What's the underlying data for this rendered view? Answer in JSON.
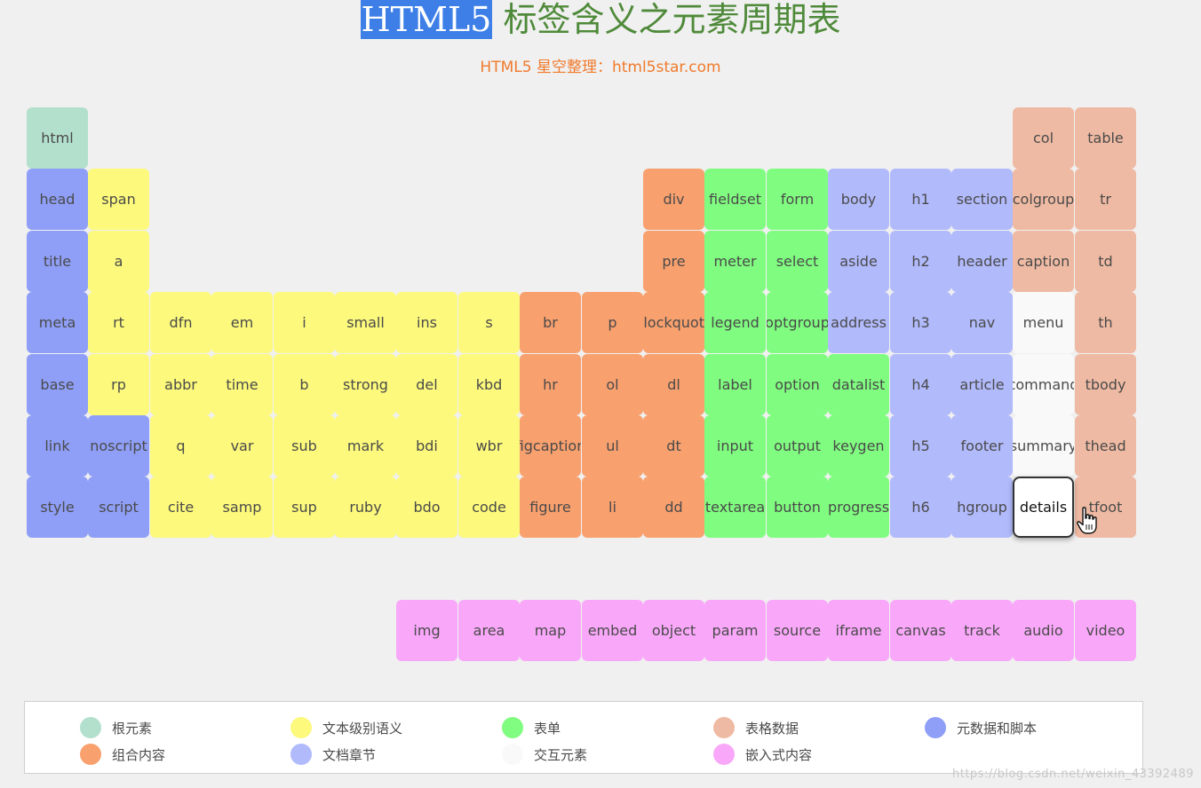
{
  "header": {
    "title_highlight": "HTML5",
    "title_rest": " 标签含义之元素周期表",
    "subtitle": "HTML5 星空整理：html5star.com"
  },
  "colors": {
    "root": "#b3e0cc",
    "text": "#fcf97c",
    "form": "#80fc80",
    "table": "#efbaa3",
    "meta": "#8f9ff7",
    "group": "#f8a06e",
    "section": "#b1bafb",
    "interactive": "#f9f9f9",
    "embed": "#f9a8f9"
  },
  "elements": [
    {
      "label": "html",
      "cat": "root",
      "col": 0,
      "row": 0
    },
    {
      "label": "col",
      "cat": "table",
      "col": 16,
      "row": 0
    },
    {
      "label": "table",
      "cat": "table",
      "col": 17,
      "row": 0
    },
    {
      "label": "head",
      "cat": "meta",
      "col": 0,
      "row": 1
    },
    {
      "label": "span",
      "cat": "text",
      "col": 1,
      "row": 1
    },
    {
      "label": "div",
      "cat": "group",
      "col": 10,
      "row": 1
    },
    {
      "label": "fieldset",
      "cat": "form",
      "col": 11,
      "row": 1
    },
    {
      "label": "form",
      "cat": "form",
      "col": 12,
      "row": 1
    },
    {
      "label": "body",
      "cat": "section",
      "col": 13,
      "row": 1
    },
    {
      "label": "h1",
      "cat": "section",
      "col": 14,
      "row": 1
    },
    {
      "label": "section",
      "cat": "section",
      "col": 15,
      "row": 1
    },
    {
      "label": "colgroup",
      "cat": "table",
      "col": 16,
      "row": 1
    },
    {
      "label": "tr",
      "cat": "table",
      "col": 17,
      "row": 1
    },
    {
      "label": "title",
      "cat": "meta",
      "col": 0,
      "row": 2
    },
    {
      "label": "a",
      "cat": "text",
      "col": 1,
      "row": 2
    },
    {
      "label": "pre",
      "cat": "group",
      "col": 10,
      "row": 2
    },
    {
      "label": "meter",
      "cat": "form",
      "col": 11,
      "row": 2
    },
    {
      "label": "select",
      "cat": "form",
      "col": 12,
      "row": 2
    },
    {
      "label": "aside",
      "cat": "section",
      "col": 13,
      "row": 2
    },
    {
      "label": "h2",
      "cat": "section",
      "col": 14,
      "row": 2
    },
    {
      "label": "header",
      "cat": "section",
      "col": 15,
      "row": 2
    },
    {
      "label": "caption",
      "cat": "table",
      "col": 16,
      "row": 2
    },
    {
      "label": "td",
      "cat": "table",
      "col": 17,
      "row": 2
    },
    {
      "label": "meta",
      "cat": "meta",
      "col": 0,
      "row": 3
    },
    {
      "label": "rt",
      "cat": "text",
      "col": 1,
      "row": 3
    },
    {
      "label": "dfn",
      "cat": "text",
      "col": 2,
      "row": 3
    },
    {
      "label": "em",
      "cat": "text",
      "col": 3,
      "row": 3
    },
    {
      "label": "i",
      "cat": "text",
      "col": 4,
      "row": 3
    },
    {
      "label": "small",
      "cat": "text",
      "col": 5,
      "row": 3
    },
    {
      "label": "ins",
      "cat": "text",
      "col": 6,
      "row": 3
    },
    {
      "label": "s",
      "cat": "text",
      "col": 7,
      "row": 3
    },
    {
      "label": "br",
      "cat": "group",
      "col": 8,
      "row": 3
    },
    {
      "label": "p",
      "cat": "group",
      "col": 9,
      "row": 3
    },
    {
      "label": "blockquote",
      "cat": "group",
      "col": 10,
      "row": 3
    },
    {
      "label": "legend",
      "cat": "form",
      "col": 11,
      "row": 3
    },
    {
      "label": "optgroup",
      "cat": "form",
      "col": 12,
      "row": 3
    },
    {
      "label": "address",
      "cat": "section",
      "col": 13,
      "row": 3
    },
    {
      "label": "h3",
      "cat": "section",
      "col": 14,
      "row": 3
    },
    {
      "label": "nav",
      "cat": "section",
      "col": 15,
      "row": 3
    },
    {
      "label": "menu",
      "cat": "interactive",
      "col": 16,
      "row": 3
    },
    {
      "label": "th",
      "cat": "table",
      "col": 17,
      "row": 3
    },
    {
      "label": "base",
      "cat": "meta",
      "col": 0,
      "row": 4
    },
    {
      "label": "rp",
      "cat": "text",
      "col": 1,
      "row": 4
    },
    {
      "label": "abbr",
      "cat": "text",
      "col": 2,
      "row": 4
    },
    {
      "label": "time",
      "cat": "text",
      "col": 3,
      "row": 4
    },
    {
      "label": "b",
      "cat": "text",
      "col": 4,
      "row": 4
    },
    {
      "label": "strong",
      "cat": "text",
      "col": 5,
      "row": 4
    },
    {
      "label": "del",
      "cat": "text",
      "col": 6,
      "row": 4
    },
    {
      "label": "kbd",
      "cat": "text",
      "col": 7,
      "row": 4
    },
    {
      "label": "hr",
      "cat": "group",
      "col": 8,
      "row": 4
    },
    {
      "label": "ol",
      "cat": "group",
      "col": 9,
      "row": 4
    },
    {
      "label": "dl",
      "cat": "group",
      "col": 10,
      "row": 4
    },
    {
      "label": "label",
      "cat": "form",
      "col": 11,
      "row": 4
    },
    {
      "label": "option",
      "cat": "form",
      "col": 12,
      "row": 4
    },
    {
      "label": "datalist",
      "cat": "form",
      "col": 13,
      "row": 4
    },
    {
      "label": "h4",
      "cat": "section",
      "col": 14,
      "row": 4
    },
    {
      "label": "article",
      "cat": "section",
      "col": 15,
      "row": 4
    },
    {
      "label": "command",
      "cat": "interactive",
      "col": 16,
      "row": 4
    },
    {
      "label": "tbody",
      "cat": "table",
      "col": 17,
      "row": 4
    },
    {
      "label": "link",
      "cat": "meta",
      "col": 0,
      "row": 5
    },
    {
      "label": "noscript",
      "cat": "meta",
      "col": 1,
      "row": 5
    },
    {
      "label": "q",
      "cat": "text",
      "col": 2,
      "row": 5
    },
    {
      "label": "var",
      "cat": "text",
      "col": 3,
      "row": 5
    },
    {
      "label": "sub",
      "cat": "text",
      "col": 4,
      "row": 5
    },
    {
      "label": "mark",
      "cat": "text",
      "col": 5,
      "row": 5
    },
    {
      "label": "bdi",
      "cat": "text",
      "col": 6,
      "row": 5
    },
    {
      "label": "wbr",
      "cat": "text",
      "col": 7,
      "row": 5
    },
    {
      "label": "figcaption",
      "cat": "group",
      "col": 8,
      "row": 5
    },
    {
      "label": "ul",
      "cat": "group",
      "col": 9,
      "row": 5
    },
    {
      "label": "dt",
      "cat": "group",
      "col": 10,
      "row": 5
    },
    {
      "label": "input",
      "cat": "form",
      "col": 11,
      "row": 5
    },
    {
      "label": "output",
      "cat": "form",
      "col": 12,
      "row": 5
    },
    {
      "label": "keygen",
      "cat": "form",
      "col": 13,
      "row": 5
    },
    {
      "label": "h5",
      "cat": "section",
      "col": 14,
      "row": 5
    },
    {
      "label": "footer",
      "cat": "section",
      "col": 15,
      "row": 5
    },
    {
      "label": "summary",
      "cat": "interactive",
      "col": 16,
      "row": 5
    },
    {
      "label": "thead",
      "cat": "table",
      "col": 17,
      "row": 5
    },
    {
      "label": "style",
      "cat": "meta",
      "col": 0,
      "row": 6
    },
    {
      "label": "script",
      "cat": "meta",
      "col": 1,
      "row": 6
    },
    {
      "label": "cite",
      "cat": "text",
      "col": 2,
      "row": 6
    },
    {
      "label": "samp",
      "cat": "text",
      "col": 3,
      "row": 6
    },
    {
      "label": "sup",
      "cat": "text",
      "col": 4,
      "row": 6
    },
    {
      "label": "ruby",
      "cat": "text",
      "col": 5,
      "row": 6
    },
    {
      "label": "bdo",
      "cat": "text",
      "col": 6,
      "row": 6
    },
    {
      "label": "code",
      "cat": "text",
      "col": 7,
      "row": 6
    },
    {
      "label": "figure",
      "cat": "group",
      "col": 8,
      "row": 6
    },
    {
      "label": "li",
      "cat": "group",
      "col": 9,
      "row": 6
    },
    {
      "label": "dd",
      "cat": "group",
      "col": 10,
      "row": 6
    },
    {
      "label": "textarea",
      "cat": "form",
      "col": 11,
      "row": 6
    },
    {
      "label": "button",
      "cat": "form",
      "col": 12,
      "row": 6
    },
    {
      "label": "progress",
      "cat": "form",
      "col": 13,
      "row": 6
    },
    {
      "label": "h6",
      "cat": "section",
      "col": 14,
      "row": 6
    },
    {
      "label": "hgroup",
      "cat": "section",
      "col": 15,
      "row": 6
    },
    {
      "label": "details",
      "cat": "interactive",
      "col": 16,
      "row": 6,
      "selected": true
    },
    {
      "label": "tfoot",
      "cat": "table",
      "col": 17,
      "row": 6
    },
    {
      "label": "img",
      "cat": "embed",
      "col": 6,
      "row": 8
    },
    {
      "label": "area",
      "cat": "embed",
      "col": 7,
      "row": 8
    },
    {
      "label": "map",
      "cat": "embed",
      "col": 8,
      "row": 8
    },
    {
      "label": "embed",
      "cat": "embed",
      "col": 9,
      "row": 8
    },
    {
      "label": "object",
      "cat": "embed",
      "col": 10,
      "row": 8
    },
    {
      "label": "param",
      "cat": "embed",
      "col": 11,
      "row": 8
    },
    {
      "label": "source",
      "cat": "embed",
      "col": 12,
      "row": 8
    },
    {
      "label": "iframe",
      "cat": "embed",
      "col": 13,
      "row": 8
    },
    {
      "label": "canvas",
      "cat": "embed",
      "col": 14,
      "row": 8
    },
    {
      "label": "track",
      "cat": "embed",
      "col": 15,
      "row": 8
    },
    {
      "label": "audio",
      "cat": "embed",
      "col": 16,
      "row": 8
    },
    {
      "label": "video",
      "cat": "embed",
      "col": 17,
      "row": 8
    }
  ],
  "legend": [
    {
      "label": "根元素",
      "cat": "root"
    },
    {
      "label": "文本级别语义",
      "cat": "text"
    },
    {
      "label": "表单",
      "cat": "form"
    },
    {
      "label": "表格数据",
      "cat": "table"
    },
    {
      "label": "元数据和脚本",
      "cat": "meta"
    },
    {
      "label": "组合内容",
      "cat": "group"
    },
    {
      "label": "文档章节",
      "cat": "section"
    },
    {
      "label": "交互元素",
      "cat": "interactive"
    },
    {
      "label": "嵌入式内容",
      "cat": "embed"
    }
  ],
  "watermark": "https://blog.csdn.net/weixin_43392489",
  "cursor_icon": "hand-pointer-icon"
}
